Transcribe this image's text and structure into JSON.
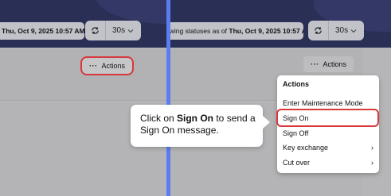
{
  "header": {
    "left_status_datetime": "Thu, Oct 9, 2025 10:57 AM",
    "right_status_prefix": "owing statuses as of ",
    "right_status_datetime": "Thu, Oct 9, 2025 10:57 AM",
    "interval": "30s"
  },
  "actions": {
    "button_label": "Actions"
  },
  "menu": {
    "title": "Actions",
    "items": [
      {
        "label": "Enter Maintenance Mode",
        "submenu": false
      },
      {
        "label": "Sign On",
        "submenu": false
      },
      {
        "label": "Sign Off",
        "submenu": false
      },
      {
        "label": "Key exchange",
        "submenu": true
      },
      {
        "label": "Cut over",
        "submenu": true
      }
    ]
  },
  "tooltip": {
    "prefix": "Click on ",
    "target": "Sign On",
    "suffix": " to send a Sign On message."
  },
  "colors": {
    "header_bg": "#2a2f55",
    "divider": "#5a7ef0",
    "highlight": "#d8373b"
  }
}
